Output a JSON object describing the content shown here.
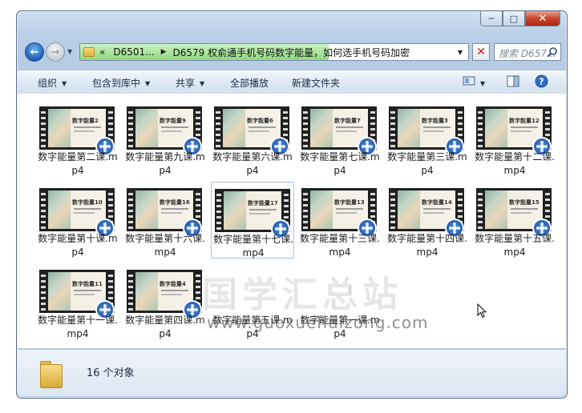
{
  "window": {
    "caption_buttons": {
      "minimize": "─",
      "maximize": "□",
      "close": "✕"
    }
  },
  "navigation": {
    "back_icon": "←",
    "forward_icon": "→",
    "address_chevron": "«",
    "breadcrumb": [
      "D6501...",
      "D6579 权俞通手机号码数字能量，如何选手机号码加密"
    ],
    "search_placeholder": "搜索 D657..."
  },
  "toolbar": {
    "organize": "组织",
    "include_in_library": "包含到库中",
    "share": "共享",
    "play_all": "全部播放",
    "new_folder": "新建文件夹"
  },
  "files": [
    {
      "name": "数字能量第二课.mp4",
      "thumb_title": "数字能量2"
    },
    {
      "name": "数字能量第九课.mp4",
      "thumb_title": "数字能量9"
    },
    {
      "name": "数字能量第六课.mp4",
      "thumb_title": "数字能量6"
    },
    {
      "name": "数字能量第七课.mp4",
      "thumb_title": "数字能量7"
    },
    {
      "name": "数字能量第三课.mp4",
      "thumb_title": "数字能量3"
    },
    {
      "name": "数字能量第十二课.mp4",
      "thumb_title": "数字能量12"
    },
    {
      "name": "数字能量第十课.mp4",
      "thumb_title": "数字能量10"
    },
    {
      "name": "数字能量第十六课.mp4",
      "thumb_title": "数字能量16"
    },
    {
      "name": "数字能量第十七课.mp4",
      "thumb_title": "数字能量17"
    },
    {
      "name": "数字能量第十三课.mp4",
      "thumb_title": "数字能量13"
    },
    {
      "name": "数字能量第十四课.mp4",
      "thumb_title": "数字能量14"
    },
    {
      "name": "数字能量第十五课.mp4",
      "thumb_title": "数字能量15"
    },
    {
      "name": "数字能量第十一课.mp4",
      "thumb_title": "数字能量11"
    },
    {
      "name": "数字能量第四课.mp4",
      "thumb_title": "数字能量4"
    },
    {
      "name": "数字能量第五课.mp4",
      "thumb_title": ""
    },
    {
      "name": "数字能量第一课.mp4",
      "thumb_title": ""
    }
  ],
  "watermark": {
    "cn": "国学汇总站",
    "url": "www.guoxuehuizong.com"
  },
  "details": {
    "count": "16 个对象"
  },
  "icons": {
    "video_overlay": "film-reel-icon",
    "folder": "folder-icon",
    "cursor": "mouse-pointer-icon"
  }
}
